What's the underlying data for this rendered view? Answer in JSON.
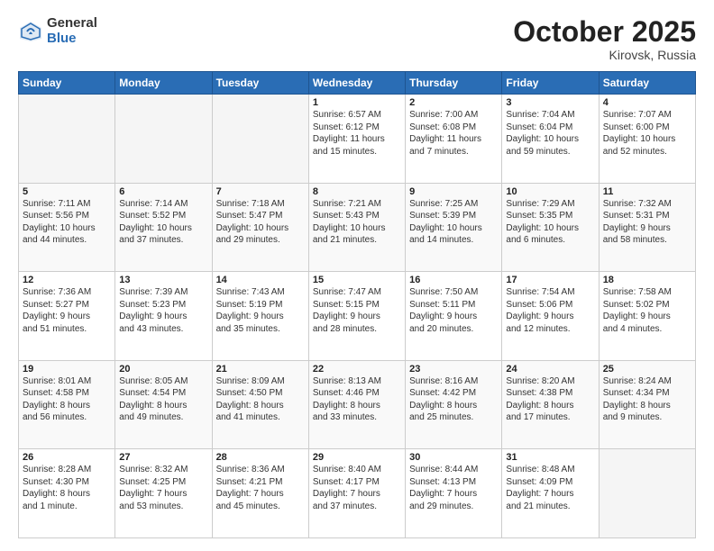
{
  "header": {
    "logo_general": "General",
    "logo_blue": "Blue",
    "month_title": "October 2025",
    "location": "Kirovsk, Russia"
  },
  "weekdays": [
    "Sunday",
    "Monday",
    "Tuesday",
    "Wednesday",
    "Thursday",
    "Friday",
    "Saturday"
  ],
  "weeks": [
    [
      {
        "day": "",
        "info": ""
      },
      {
        "day": "",
        "info": ""
      },
      {
        "day": "",
        "info": ""
      },
      {
        "day": "1",
        "info": "Sunrise: 6:57 AM\nSunset: 6:12 PM\nDaylight: 11 hours\nand 15 minutes."
      },
      {
        "day": "2",
        "info": "Sunrise: 7:00 AM\nSunset: 6:08 PM\nDaylight: 11 hours\nand 7 minutes."
      },
      {
        "day": "3",
        "info": "Sunrise: 7:04 AM\nSunset: 6:04 PM\nDaylight: 10 hours\nand 59 minutes."
      },
      {
        "day": "4",
        "info": "Sunrise: 7:07 AM\nSunset: 6:00 PM\nDaylight: 10 hours\nand 52 minutes."
      }
    ],
    [
      {
        "day": "5",
        "info": "Sunrise: 7:11 AM\nSunset: 5:56 PM\nDaylight: 10 hours\nand 44 minutes."
      },
      {
        "day": "6",
        "info": "Sunrise: 7:14 AM\nSunset: 5:52 PM\nDaylight: 10 hours\nand 37 minutes."
      },
      {
        "day": "7",
        "info": "Sunrise: 7:18 AM\nSunset: 5:47 PM\nDaylight: 10 hours\nand 29 minutes."
      },
      {
        "day": "8",
        "info": "Sunrise: 7:21 AM\nSunset: 5:43 PM\nDaylight: 10 hours\nand 21 minutes."
      },
      {
        "day": "9",
        "info": "Sunrise: 7:25 AM\nSunset: 5:39 PM\nDaylight: 10 hours\nand 14 minutes."
      },
      {
        "day": "10",
        "info": "Sunrise: 7:29 AM\nSunset: 5:35 PM\nDaylight: 10 hours\nand 6 minutes."
      },
      {
        "day": "11",
        "info": "Sunrise: 7:32 AM\nSunset: 5:31 PM\nDaylight: 9 hours\nand 58 minutes."
      }
    ],
    [
      {
        "day": "12",
        "info": "Sunrise: 7:36 AM\nSunset: 5:27 PM\nDaylight: 9 hours\nand 51 minutes."
      },
      {
        "day": "13",
        "info": "Sunrise: 7:39 AM\nSunset: 5:23 PM\nDaylight: 9 hours\nand 43 minutes."
      },
      {
        "day": "14",
        "info": "Sunrise: 7:43 AM\nSunset: 5:19 PM\nDaylight: 9 hours\nand 35 minutes."
      },
      {
        "day": "15",
        "info": "Sunrise: 7:47 AM\nSunset: 5:15 PM\nDaylight: 9 hours\nand 28 minutes."
      },
      {
        "day": "16",
        "info": "Sunrise: 7:50 AM\nSunset: 5:11 PM\nDaylight: 9 hours\nand 20 minutes."
      },
      {
        "day": "17",
        "info": "Sunrise: 7:54 AM\nSunset: 5:06 PM\nDaylight: 9 hours\nand 12 minutes."
      },
      {
        "day": "18",
        "info": "Sunrise: 7:58 AM\nSunset: 5:02 PM\nDaylight: 9 hours\nand 4 minutes."
      }
    ],
    [
      {
        "day": "19",
        "info": "Sunrise: 8:01 AM\nSunset: 4:58 PM\nDaylight: 8 hours\nand 56 minutes."
      },
      {
        "day": "20",
        "info": "Sunrise: 8:05 AM\nSunset: 4:54 PM\nDaylight: 8 hours\nand 49 minutes."
      },
      {
        "day": "21",
        "info": "Sunrise: 8:09 AM\nSunset: 4:50 PM\nDaylight: 8 hours\nand 41 minutes."
      },
      {
        "day": "22",
        "info": "Sunrise: 8:13 AM\nSunset: 4:46 PM\nDaylight: 8 hours\nand 33 minutes."
      },
      {
        "day": "23",
        "info": "Sunrise: 8:16 AM\nSunset: 4:42 PM\nDaylight: 8 hours\nand 25 minutes."
      },
      {
        "day": "24",
        "info": "Sunrise: 8:20 AM\nSunset: 4:38 PM\nDaylight: 8 hours\nand 17 minutes."
      },
      {
        "day": "25",
        "info": "Sunrise: 8:24 AM\nSunset: 4:34 PM\nDaylight: 8 hours\nand 9 minutes."
      }
    ],
    [
      {
        "day": "26",
        "info": "Sunrise: 8:28 AM\nSunset: 4:30 PM\nDaylight: 8 hours\nand 1 minute."
      },
      {
        "day": "27",
        "info": "Sunrise: 8:32 AM\nSunset: 4:25 PM\nDaylight: 7 hours\nand 53 minutes."
      },
      {
        "day": "28",
        "info": "Sunrise: 8:36 AM\nSunset: 4:21 PM\nDaylight: 7 hours\nand 45 minutes."
      },
      {
        "day": "29",
        "info": "Sunrise: 8:40 AM\nSunset: 4:17 PM\nDaylight: 7 hours\nand 37 minutes."
      },
      {
        "day": "30",
        "info": "Sunrise: 8:44 AM\nSunset: 4:13 PM\nDaylight: 7 hours\nand 29 minutes."
      },
      {
        "day": "31",
        "info": "Sunrise: 8:48 AM\nSunset: 4:09 PM\nDaylight: 7 hours\nand 21 minutes."
      },
      {
        "day": "",
        "info": ""
      }
    ]
  ]
}
